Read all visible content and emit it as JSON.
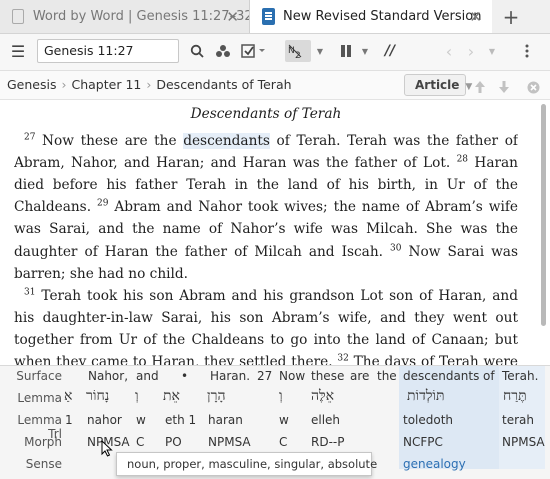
{
  "tabs": [
    {
      "label": "Word by Word | Genesis 11:27–32"
    },
    {
      "label": "New Revised Standard Version"
    }
  ],
  "toolbar": {
    "reference": "Genesis 11:27"
  },
  "breadcrumb": [
    "Genesis",
    "Chapter 11",
    "Descendants of Terah"
  ],
  "article_label": "Article",
  "passage": {
    "heading": "Descendants of Terah",
    "p1": [
      {
        "n": "27",
        "text": " Now these are the "
      },
      {
        "hl": "descendants"
      },
      {
        "text": " of Terah. Terah was the father of Abram, Nahor, and Haran; and Haran was the father of Lot. "
      },
      {
        "n": "28",
        "text": " Haran died before his father Terah in the land of his birth, in Ur of the Chaldeans. "
      },
      {
        "n": "29",
        "text": " Abram and Nahor took wives; the name of Abram’s wife was Sarai, and the name of Nahor’s wife was Milcah. She was the daughter of Haran the father of Milcah and Iscah. "
      },
      {
        "n": "30",
        "text": " Now Sarai was barren; she had no child."
      }
    ],
    "p2": [
      {
        "n": "31",
        "text": " Terah took his son Abram and his grandson Lot son of Haran, and his daughter-in-law Sarai, his son Abram’s wife, and they went out together from Ur of the Chaldeans to go into the land of Canaan; but when they came to Haran, they settled there. "
      },
      {
        "n": "32",
        "text": " The days of Terah were two hundred five years; and Terah died in Haran."
      }
    ]
  },
  "interlinear": {
    "labels": [
      "Surface",
      "Lemma",
      "Lemma Trl",
      "Morph",
      "Sense"
    ],
    "surface": [
      "Nahor,",
      "and",
      "•",
      "Haran.",
      "27",
      "Now",
      "these",
      "are",
      "the",
      "descendants",
      "of",
      "Terah."
    ],
    "lemma": [
      "אַ",
      "נָחוֹר",
      "וְ",
      "אֵת",
      "הָרָן",
      "וְ",
      "אֵלֶּה",
      "תּוֹלְדוֹת",
      "תֶּרַח"
    ],
    "lemma_trl": [
      "1",
      "nahor",
      "w",
      "eth 1",
      "haran",
      "w",
      "elleh",
      "toledoth",
      "terah"
    ],
    "morph": [
      "NPMSA",
      "C",
      "PO",
      "NPMSA",
      "C",
      "RD--P",
      "NCFPC",
      "NPMSA"
    ],
    "sense": [
      "genealogy"
    ]
  },
  "tooltip": "noun, proper, masculine, singular, absolute"
}
